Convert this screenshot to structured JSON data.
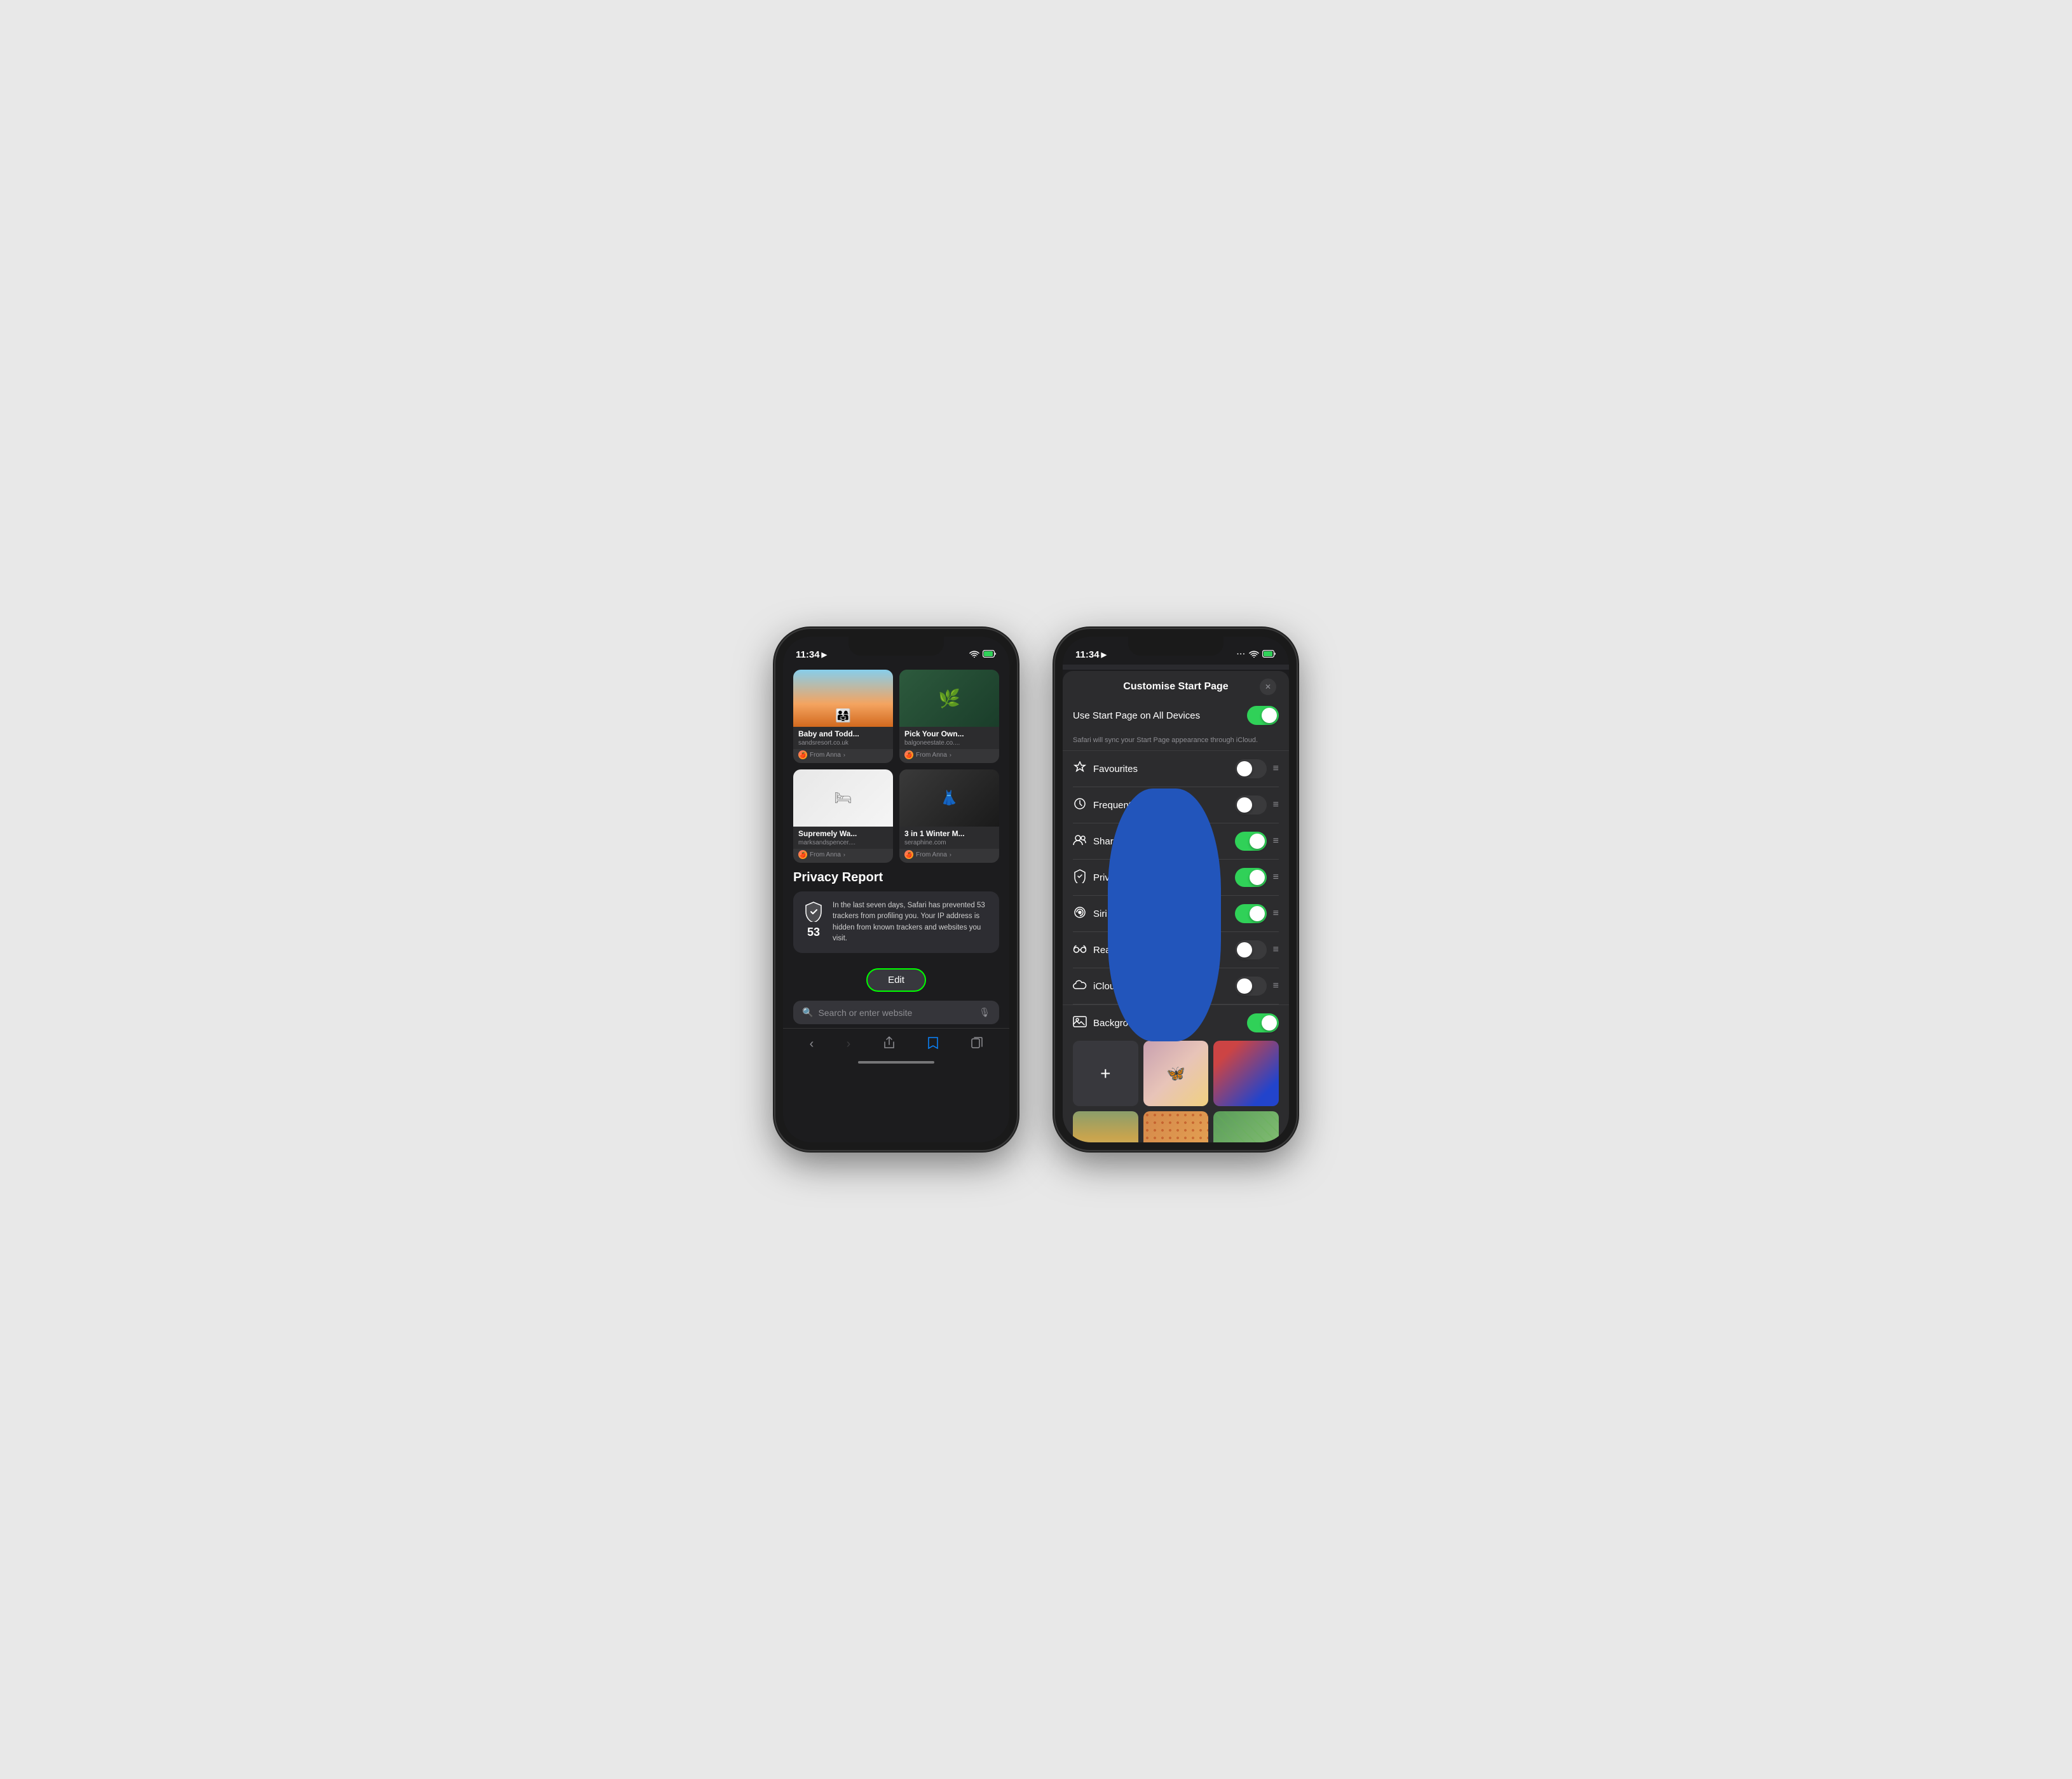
{
  "phone1": {
    "status": {
      "time": "11:34",
      "location_icon": "▶",
      "wifi_icon": "wifi",
      "battery_icon": "battery"
    },
    "cards": [
      {
        "title": "Baby and Todd...",
        "url": "sandsresort.co.uk",
        "from": "From Anna",
        "img_type": "beach"
      },
      {
        "title": "Pick Your Own...",
        "url": "balgoneestate.co....",
        "from": "From Anna",
        "img_type": "green"
      },
      {
        "title": "Supremely Wa...",
        "url": "marksandspencer....",
        "from": "From Anna",
        "img_type": "white"
      },
      {
        "title": "3 in 1 Winter M...",
        "url": "seraphine.com",
        "from": "From Anna",
        "img_type": "black"
      }
    ],
    "privacy": {
      "title": "Privacy Report",
      "count": "53",
      "description": "In the last seven days, Safari has prevented 53 trackers from profiling you. Your IP address is hidden from known trackers and websites you visit."
    },
    "edit_button": "Edit",
    "search_placeholder": "Search or enter website",
    "nav": {
      "back": "‹",
      "forward": "›",
      "share": "share",
      "bookmarks": "bookmarks",
      "tabs": "tabs"
    }
  },
  "phone2": {
    "status": {
      "time": "11:34",
      "location_icon": "▶"
    },
    "modal": {
      "title": "Customise Start Page",
      "close_label": "✕"
    },
    "sync_toggle": {
      "label": "Use Start Page on All Devices",
      "state": "on",
      "description": "Safari will sync your Start Page appearance through iCloud."
    },
    "settings": [
      {
        "icon": "☆",
        "label": "Favourites",
        "state": "off"
      },
      {
        "icon": "🕐",
        "label": "Frequently Visited",
        "state": "off"
      },
      {
        "icon": "👥",
        "label": "Shared with You",
        "state": "on"
      },
      {
        "icon": "🛡",
        "label": "Privacy Report",
        "state": "on"
      },
      {
        "icon": "⊗",
        "label": "Siri Suggestions",
        "state": "on"
      },
      {
        "icon": "◎",
        "label": "Reading List",
        "state": "off"
      },
      {
        "icon": "☁",
        "label": "iCloud Tabs",
        "state": "off"
      }
    ],
    "background": {
      "label": "Background Image",
      "state": "on",
      "add_label": "+"
    }
  }
}
